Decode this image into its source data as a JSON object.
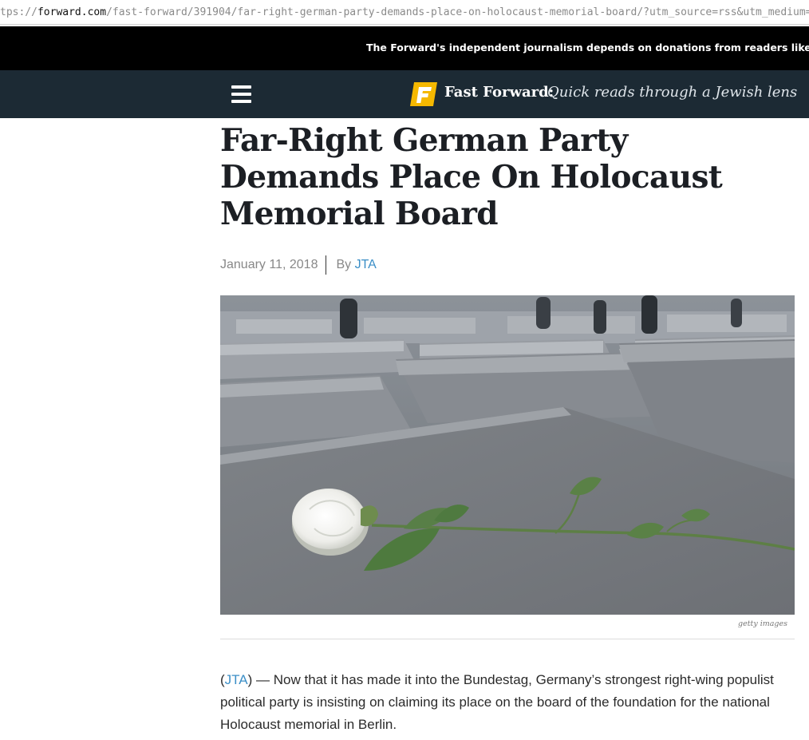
{
  "browser": {
    "url_scheme_part": "tps://",
    "url_domain": "forward.com",
    "url_path": "/fast-forward/391904/far-right-german-party-demands-place-on-holocaust-memorial-board/?utm_source=rss&utm_medium=r"
  },
  "donate_banner": {
    "text": "The Forward's independent journalism depends on donations from readers like you"
  },
  "nav": {
    "menu_icon": "hamburger-menu-icon",
    "logo_letter": "F",
    "section_title": "Fast Forward:",
    "section_tagline": "Quick reads through a Jewish lens",
    "colors": {
      "bar": "#1c2a34",
      "logo": "#f5b800"
    }
  },
  "article": {
    "headline": "Far-Right German Party Demands Place On Holocaust Memorial Board",
    "date": "January 11, 2018",
    "byline_prefix": "By",
    "author": "JTA",
    "image_caption": "getty images",
    "body_open_paren": "(",
    "body_source_link": "JTA",
    "body_text": ") — Now that it has made it into the Bundestag, Germany’s strongest right-wing populist political party is insisting on claiming its place on the board of the foundation for the national Holocaust memorial in Berlin."
  },
  "colors": {
    "link": "#3c8fc7",
    "headline": "#1c1f24"
  }
}
